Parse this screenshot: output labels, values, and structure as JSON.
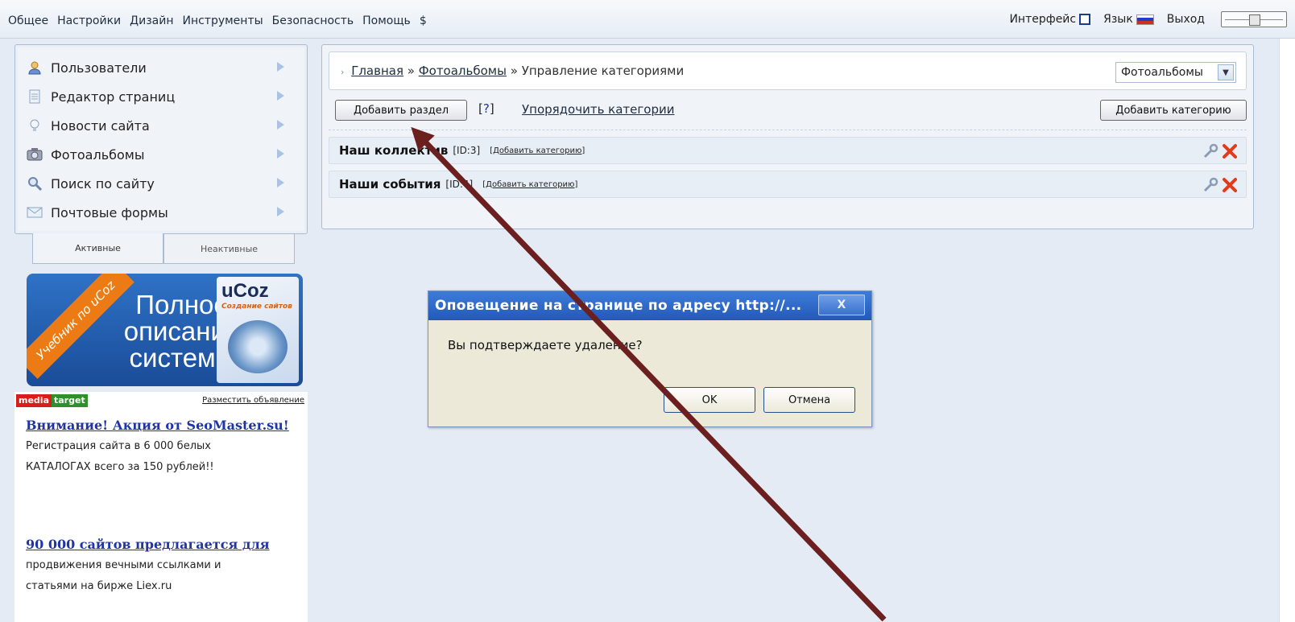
{
  "topmenu": [
    "Общее",
    "Настройки",
    "Дизайн",
    "Инструменты",
    "Безопасность",
    "Помощь",
    "$"
  ],
  "topright": {
    "interface": "Интерфейс",
    "lang": "Язык",
    "logout": "Выход"
  },
  "sidebar": {
    "items": [
      {
        "label": "Пользователи",
        "icon": "user-icon"
      },
      {
        "label": "Редактор страниц",
        "icon": "page-icon"
      },
      {
        "label": "Новости сайта",
        "icon": "bulb-icon"
      },
      {
        "label": "Фотоальбомы",
        "icon": "camera-icon"
      },
      {
        "label": "Поиск по сайту",
        "icon": "search-icon"
      },
      {
        "label": "Почтовые формы",
        "icon": "mail-icon"
      }
    ],
    "tabs": {
      "active": "Активные",
      "inactive": "Неактивные"
    }
  },
  "banner": {
    "ribbon": "Учебник по uCoz",
    "text_line1": "Полное",
    "text_line2": "описание",
    "text_line3": "системы",
    "logo": "uCoz",
    "sub": "Создание сайтов"
  },
  "mediatarget": {
    "media": "media",
    "target": "target",
    "place": "Разместить объявление"
  },
  "ads": [
    {
      "title": "Внимание! Акция от SeoMaster.su!",
      "text1": "Регистрация сайта в 6 000 белых",
      "text2": "КАТАЛОГАХ всего за 150 рублей!!"
    },
    {
      "title": "90 000 сайтов предлагается для",
      "text1": "продвижения вечными ссылками и",
      "text2": "статьями на бирже Liex.ru"
    }
  ],
  "breadcrumb": {
    "home": "Главная",
    "sep": "»",
    "albums": "Фотоальбомы",
    "current": "Управление категориями"
  },
  "album_select": {
    "value": "Фотоальбомы"
  },
  "toolbar": {
    "add_section": "Добавить раздел",
    "help": "?",
    "order": "Упорядочить категории",
    "add_category": "Добавить категорию"
  },
  "categories": [
    {
      "name": "Наш коллектив",
      "id": "[ID:3]",
      "add": "Добавить категорию"
    },
    {
      "name": "Наши события",
      "id": "[ID:4]",
      "add": "Добавить категорию"
    }
  ],
  "dialog": {
    "title": "Оповещение на странице по адресу http://...",
    "close": "X",
    "message": "Вы подтверждаете удаление?",
    "ok": "OK",
    "cancel": "Отмена"
  },
  "colors": {
    "arrow": "#6b1f1f",
    "flag_white": "#ffffff",
    "flag_blue": "#1d3ec9",
    "flag_red": "#d52b1e"
  }
}
